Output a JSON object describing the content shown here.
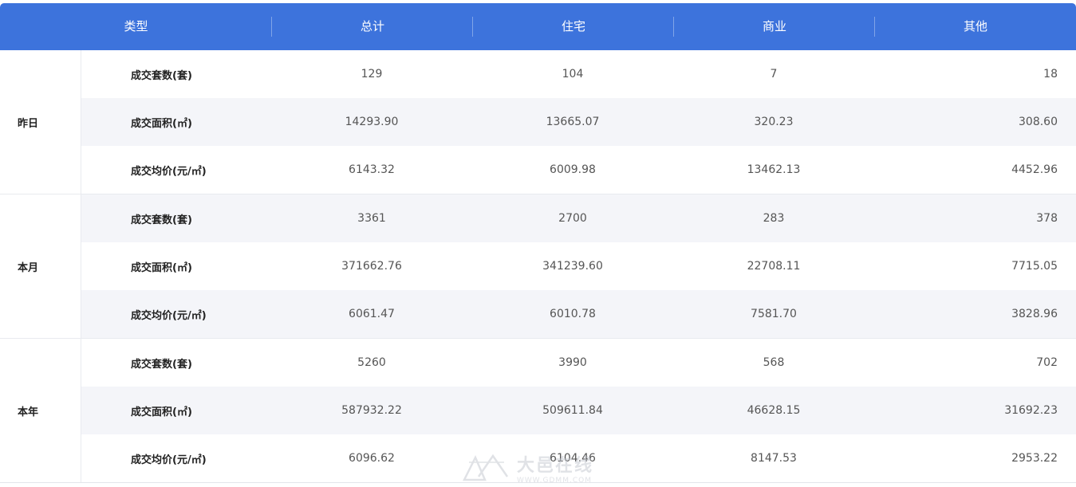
{
  "header": {
    "type": "类型",
    "total": "总计",
    "residential": "住宅",
    "commercial": "商业",
    "other": "其他"
  },
  "groups": [
    {
      "period": "昨日",
      "rows": [
        {
          "metric": "成交套数(套)",
          "total": "129",
          "residential": "104",
          "commercial": "7",
          "other": "18"
        },
        {
          "metric": "成交面积(㎡)",
          "total": "14293.90",
          "residential": "13665.07",
          "commercial": "320.23",
          "other": "308.60"
        },
        {
          "metric": "成交均价(元/㎡)",
          "total": "6143.32",
          "residential": "6009.98",
          "commercial": "13462.13",
          "other": "4452.96"
        }
      ]
    },
    {
      "period": "本月",
      "rows": [
        {
          "metric": "成交套数(套)",
          "total": "3361",
          "residential": "2700",
          "commercial": "283",
          "other": "378"
        },
        {
          "metric": "成交面积(㎡)",
          "total": "371662.76",
          "residential": "341239.60",
          "commercial": "22708.11",
          "other": "7715.05"
        },
        {
          "metric": "成交均价(元/㎡)",
          "total": "6061.47",
          "residential": "6010.78",
          "commercial": "7581.70",
          "other": "3828.96"
        }
      ]
    },
    {
      "period": "本年",
      "rows": [
        {
          "metric": "成交套数(套)",
          "total": "5260",
          "residential": "3990",
          "commercial": "568",
          "other": "702"
        },
        {
          "metric": "成交面积(㎡)",
          "total": "587932.22",
          "residential": "509611.84",
          "commercial": "46628.15",
          "other": "31692.23"
        },
        {
          "metric": "成交均价(元/㎡)",
          "total": "6096.62",
          "residential": "6104.46",
          "commercial": "8147.53",
          "other": "2953.22"
        }
      ]
    }
  ],
  "watermark": {
    "text_cn": "大邑在线",
    "url": "WWW.GDMM.COM",
    "icon": "watermark-logo-icon"
  },
  "colors": {
    "header_bg": "#3d73dc",
    "row_alt_bg": "#f4f5f9",
    "text": "#555555"
  }
}
